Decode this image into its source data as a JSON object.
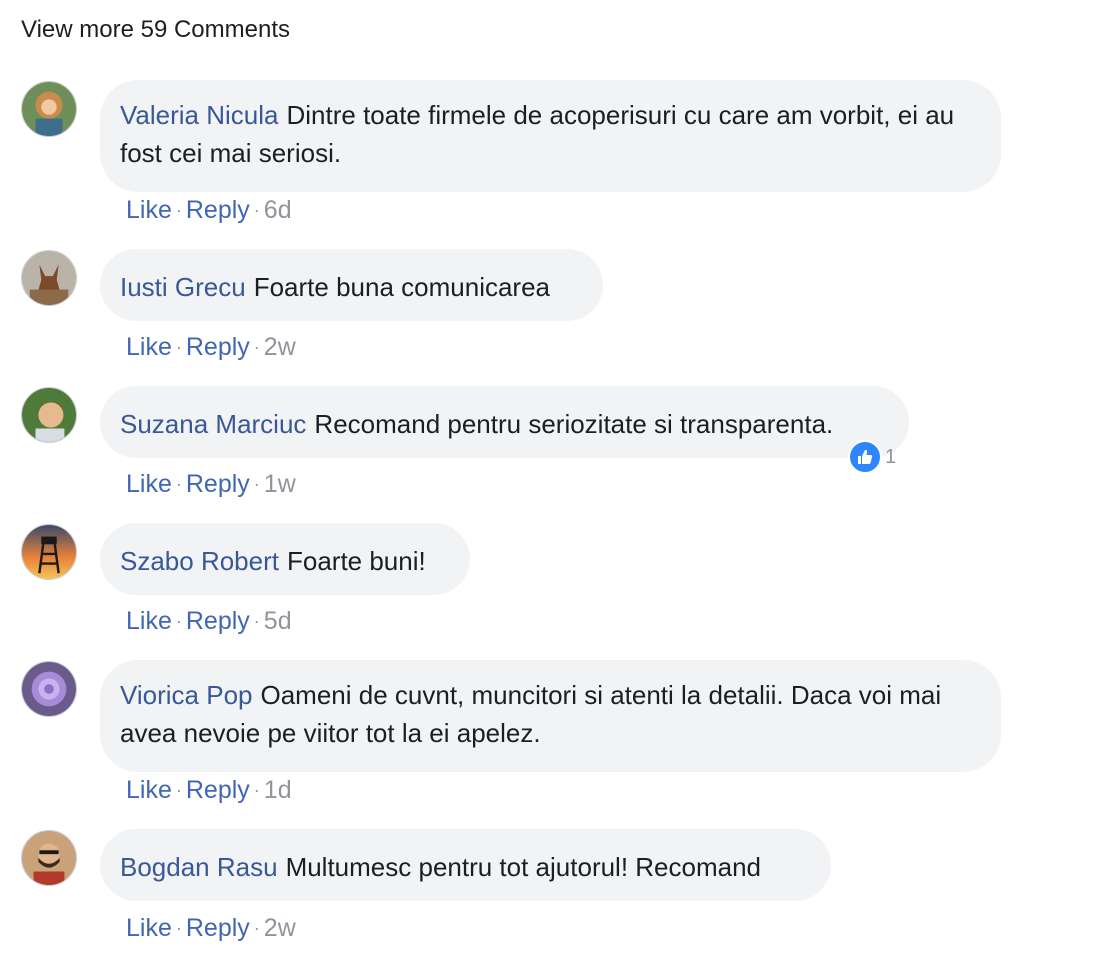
{
  "view_more": "View more 59 Comments",
  "actions": {
    "like": "Like",
    "reply": "Reply",
    "separator": "·"
  },
  "comments": [
    {
      "author": "Valeria Nicula",
      "text": "Dintre toate firmele de acoperisuri cu care am vorbit, ei au fost cei mai seriosi.",
      "time": "6d"
    },
    {
      "author": "Iusti Grecu",
      "text": "Foarte buna comunicarea",
      "time": "2w"
    },
    {
      "author": "Suzana Marciuc",
      "text": "Recomand pentru seriozitate si transparenta.",
      "time": "1w",
      "reaction_count": "1",
      "reaction_icon": "like-icon"
    },
    {
      "author": "Szabo Robert",
      "text": "Foarte buni!",
      "time": "5d"
    },
    {
      "author": "Viorica Pop",
      "text": "Oameni de cuvnt, muncitori si atenti la detalii. Daca voi mai avea nevoie pe viitor tot la ei apelez.",
      "time": "1d"
    },
    {
      "author": "Bogdan Rasu",
      "text": "Multumesc pentru tot ajutorul! Recomand",
      "time": "2w"
    }
  ],
  "colors": {
    "author": "#385898",
    "link": "#4267b2",
    "meta": "#90949c",
    "bubble": "#f2f3f5",
    "like_badge": "#2d86ff"
  }
}
